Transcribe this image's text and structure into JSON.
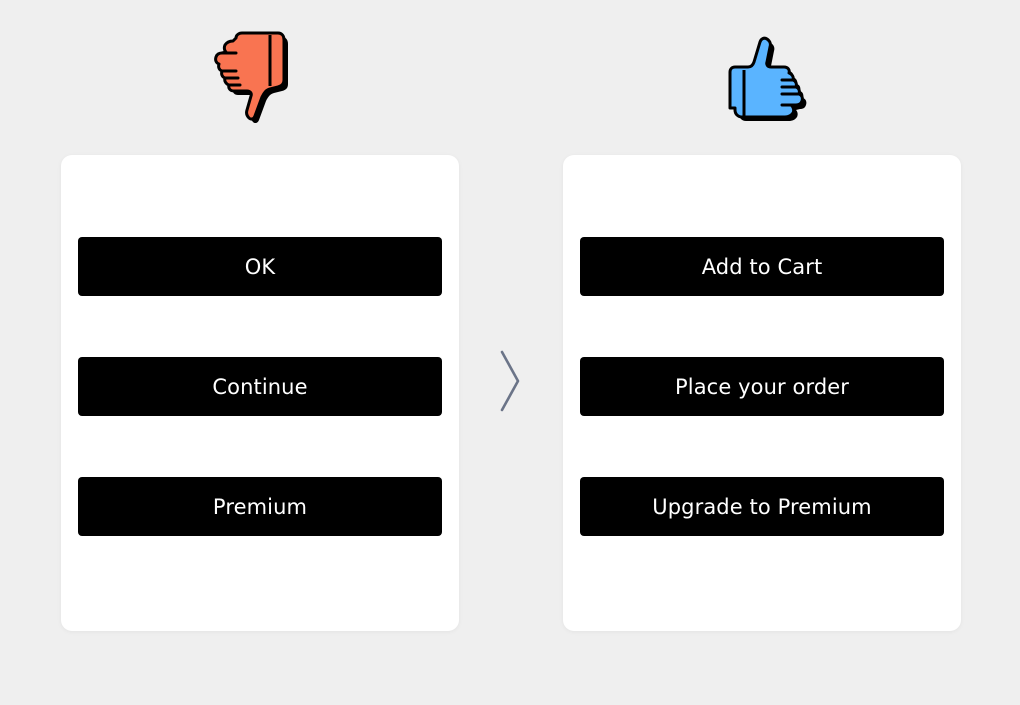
{
  "colors": {
    "background": "#efefef",
    "card": "#ffffff",
    "button": "#000000",
    "button_text": "#ffffff",
    "thumbs_down": "#f97451",
    "thumbs_up": "#5ab4ff",
    "arrow": "#6b7488"
  },
  "icons": {
    "bad": "thumbs-down-icon",
    "good": "thumbs-up-icon",
    "divider": "chevron-right-icon"
  },
  "bad_example": {
    "buttons": [
      {
        "label": "OK"
      },
      {
        "label": "Continue"
      },
      {
        "label": "Premium"
      }
    ]
  },
  "good_example": {
    "buttons": [
      {
        "label": "Add to Cart"
      },
      {
        "label": "Place your order"
      },
      {
        "label": "Upgrade to Premium"
      }
    ]
  }
}
